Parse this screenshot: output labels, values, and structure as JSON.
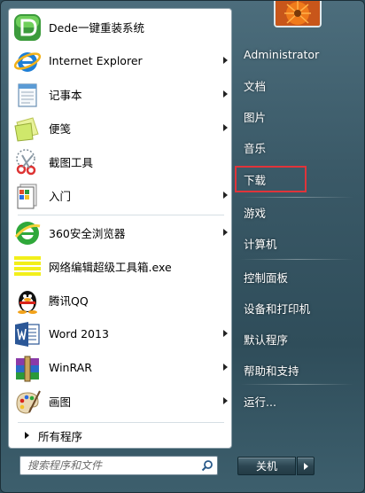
{
  "programs": [
    {
      "label": "Dede一键重装系统",
      "icon": "dede-icon",
      "arrow": false
    },
    {
      "label": "Internet Explorer",
      "icon": "internet-explorer-icon",
      "arrow": true
    },
    {
      "label": "记事本",
      "icon": "notepad-icon",
      "arrow": true
    },
    {
      "label": "便笺",
      "icon": "sticky-notes-icon",
      "arrow": true
    },
    {
      "label": "截图工具",
      "icon": "snipping-tool-icon",
      "arrow": false
    },
    {
      "label": "入门",
      "icon": "getting-started-icon",
      "arrow": true
    },
    {
      "label": "360安全浏览器",
      "icon": "360-browser-icon",
      "arrow": true
    },
    {
      "label": "网络编辑超级工具箱.exe",
      "icon": "toolbox-icon",
      "arrow": false
    },
    {
      "label": "腾讯QQ",
      "icon": "qq-penguin-icon",
      "arrow": false
    },
    {
      "label": "Word 2013",
      "icon": "word-icon",
      "arrow": true
    },
    {
      "label": "WinRAR",
      "icon": "winrar-icon",
      "arrow": true
    },
    {
      "label": "画图",
      "icon": "paint-icon",
      "arrow": true
    }
  ],
  "all_programs": "所有程序",
  "search": {
    "placeholder": "搜索程序和文件"
  },
  "right_items": [
    {
      "label": "Administrator"
    },
    {
      "label": "文档"
    },
    {
      "label": "图片"
    },
    {
      "label": "音乐"
    },
    {
      "label": "下载"
    },
    {
      "label": "游戏"
    },
    {
      "label": "计算机"
    },
    {
      "label": "控制面板"
    },
    {
      "label": "设备和打印机"
    },
    {
      "label": "默认程序"
    },
    {
      "label": "帮助和支持"
    },
    {
      "label": "运行..."
    }
  ],
  "shutdown_label": "关机",
  "colors": {
    "highlight_border": "#e0343a"
  }
}
